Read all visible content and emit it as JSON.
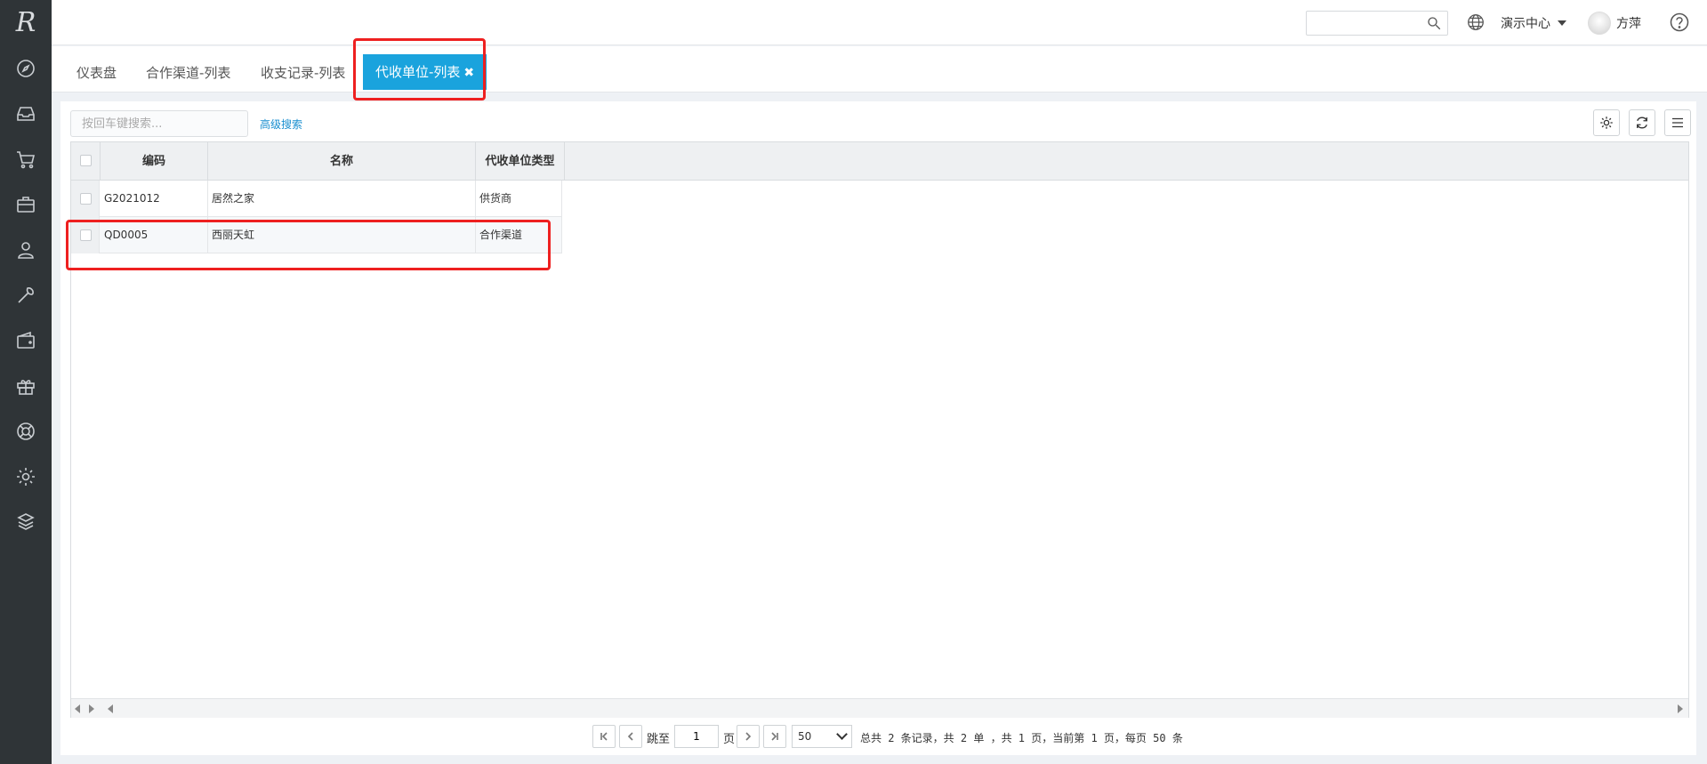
{
  "sidebar": {
    "logo_text": "R",
    "icons": [
      "compass-icon",
      "inbox-icon",
      "cart-icon",
      "briefcase-icon",
      "user-icon",
      "wrench-icon",
      "wallet-icon",
      "gift-icon",
      "lifebuoy-icon",
      "gear-icon",
      "box-stack-icon"
    ]
  },
  "header": {
    "center_label": "演示中心",
    "username": "方萍"
  },
  "tabs": [
    {
      "label": "仪表盘"
    },
    {
      "label": "合作渠道-列表"
    },
    {
      "label": "收支记录-列表"
    },
    {
      "label": "代收单位-列表",
      "active": true,
      "close": "✖"
    }
  ],
  "toolbar": {
    "search_placeholder": "按回车键搜索...",
    "advanced_search": "高级搜索"
  },
  "table": {
    "columns": [
      "编码",
      "名称",
      "代收单位类型"
    ],
    "rows": [
      {
        "code": "G2021012",
        "name": "居然之家",
        "type": "供货商"
      },
      {
        "code": "QD0005",
        "name": "西丽天虹",
        "type": "合作渠道"
      }
    ]
  },
  "pager": {
    "goto_label": "跳至",
    "page_value": "1",
    "page_unit": "页",
    "page_size": "50",
    "summary": "总共 2 条记录，共 2 单 ，共 1 页，当前第 1 页，每页 50 条"
  },
  "colors": {
    "sidebar_bg": "#2f3437",
    "accent": "#1aa3dd",
    "highlight": "#ee2020"
  }
}
